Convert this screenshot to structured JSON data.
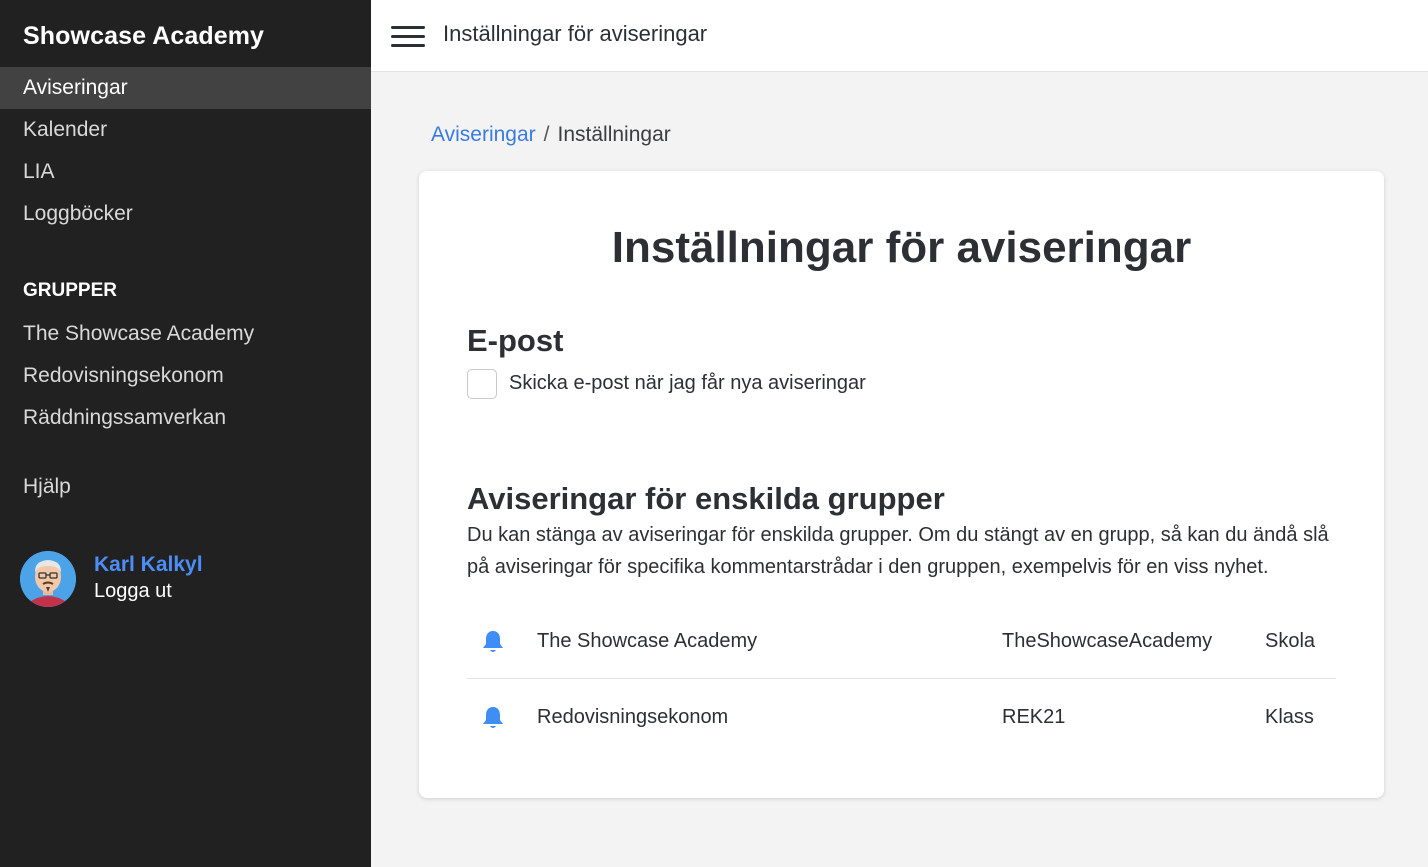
{
  "app": {
    "brand": "Showcase Academy"
  },
  "sidebar": {
    "items": [
      {
        "label": "Aviseringar",
        "active": true
      },
      {
        "label": "Kalender"
      },
      {
        "label": "LIA"
      },
      {
        "label": "Loggböcker"
      }
    ],
    "groups_heading": "GRUPPER",
    "groups": [
      {
        "label": "The Showcase Academy"
      },
      {
        "label": "Redovisningsekonom"
      },
      {
        "label": "Räddningssamverkan"
      }
    ],
    "help_label": "Hjälp"
  },
  "user": {
    "name": "Karl Kalkyl",
    "logout_label": "Logga ut"
  },
  "header": {
    "title": "Inställningar för aviseringar"
  },
  "breadcrumb": {
    "parent": "Aviseringar",
    "separator": "/",
    "current": "Inställningar"
  },
  "card": {
    "title": "Inställningar för aviseringar",
    "email": {
      "heading": "E-post",
      "checkbox_label": "Skicka e-post när jag får nya aviseringar",
      "checked": false
    },
    "groups": {
      "heading": "Aviseringar för enskilda grupper",
      "description": "Du kan stänga av aviseringar för enskilda grupper. Om du stängt av en grupp, så kan du ändå slå på aviseringar för specifika kommentarstrådar i den gruppen, exempelvis för en viss nyhet.",
      "rows": [
        {
          "name": "The Showcase Academy",
          "slug": "TheShowcaseAcademy",
          "type": "Skola",
          "icon": "bell-icon"
        },
        {
          "name": "Redovisningsekonom",
          "slug": "REK21",
          "type": "Klass",
          "icon": "bell-icon"
        }
      ]
    }
  },
  "colors": {
    "sidebar_bg": "#212121",
    "sidebar_active": "#424242",
    "accent": "#3a7be0",
    "bell": "#3f8ef5"
  }
}
